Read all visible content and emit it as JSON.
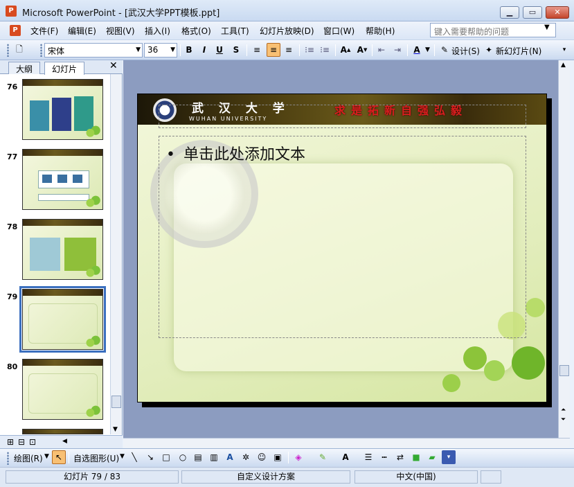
{
  "window": {
    "title": "Microsoft PowerPoint - [武汉大学PPT模板.ppt]"
  },
  "menu": [
    "文件(F)",
    "编辑(E)",
    "视图(V)",
    "插入(I)",
    "格式(O)",
    "工具(T)",
    "幻灯片放映(D)",
    "窗口(W)",
    "帮助(H)"
  ],
  "help_placeholder": "键入需要帮助的问题",
  "formatting": {
    "font": "宋体",
    "size": "36",
    "design_label": "设计(S)",
    "new_slide_label": "新幻灯片(N)"
  },
  "panel_tabs": [
    "大纲",
    "幻灯片"
  ],
  "thumbnails": [
    {
      "num": "76",
      "selected": false
    },
    {
      "num": "77",
      "selected": false
    },
    {
      "num": "78",
      "selected": false
    },
    {
      "num": "79",
      "selected": true
    },
    {
      "num": "80",
      "selected": false
    }
  ],
  "slide": {
    "university_cn": "武 汉 大 学",
    "university_en": "WUHAN UNIVERSITY",
    "motto": "求是拓新自强弘毅",
    "bullet": "•",
    "body_text": "单击此处添加文本"
  },
  "drawing": {
    "draw_label": "绘图(R)",
    "autoshapes_label": "自选图形(U)"
  },
  "status": {
    "slide_info": "幻灯片 79 / 83",
    "design": "自定义设计方案",
    "language": "中文(中国)"
  },
  "colors": {
    "accent_selected": "#3a6fbf",
    "motto_red": "#d81e1e"
  }
}
